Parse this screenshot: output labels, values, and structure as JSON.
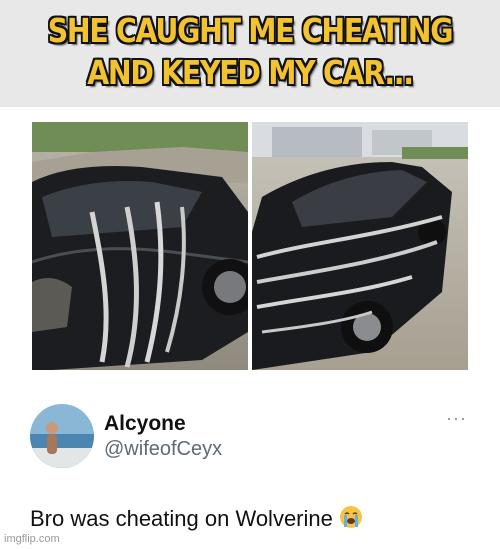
{
  "meme": {
    "caption_line1": "SHE CAUGHT ME CHEATING",
    "caption_line2": "AND KEYED MY CAR..."
  },
  "post": {
    "display_name": "Alcyone",
    "handle": "@wifeofCeyx",
    "more_label": "···",
    "text": "Bro was cheating on Wolverine",
    "emoji": "loudly-crying-face"
  },
  "watermark": "imgflip.com"
}
